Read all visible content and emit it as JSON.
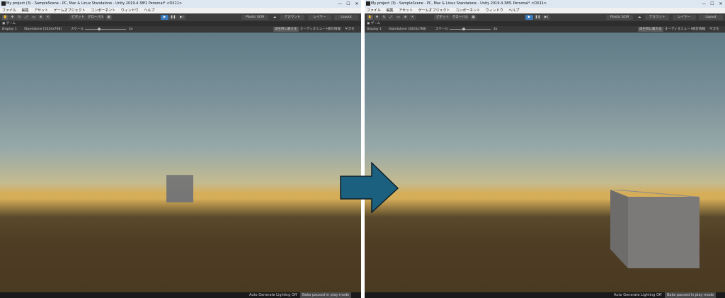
{
  "window": {
    "title": "My project (3) - SampleScene - PC, Mac & Linux Standalone - Unity 2019.4.38f1 Personal* <DX11>",
    "minimize": "—",
    "maximize": "☐",
    "close": "✕"
  },
  "menu": [
    "ファイル",
    "編集",
    "アセット",
    "ゲームオブジェクト",
    "コンポーネント",
    "ウィンドウ",
    "ヘルプ"
  ],
  "toolbar": {
    "pivot": "ピボット",
    "global": "グローバル",
    "play": "▶",
    "pause": "❚❚",
    "step": "▶|",
    "plastic": "Plastic SCM",
    "account": "アカウント",
    "layers": "レイヤー",
    "layout": "Layout"
  },
  "game": {
    "tab_label": "ゲーム",
    "display": "Display 1",
    "resolution": "Standalone (1024x768)",
    "scale_label": "スケール",
    "scale_value": "2x",
    "maximize_on_play": "再生時に最大化",
    "mute_audio": "オーディオミュート",
    "stats": "統計情報",
    "gizmos": "ギズモ"
  },
  "status": {
    "lighting": "Auto Generate Lighting Off",
    "bake": "Bake paused in play mode"
  },
  "colors": {
    "arrow": "#1b607e",
    "play_active": "#3a79bb",
    "cube": "#787777"
  }
}
